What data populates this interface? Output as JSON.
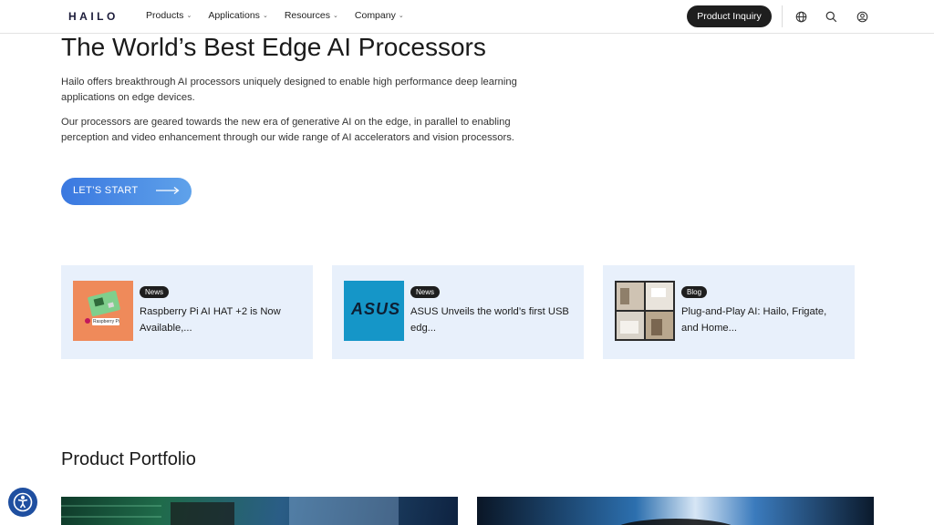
{
  "header": {
    "logo": "HAILO",
    "nav": [
      {
        "label": "Products"
      },
      {
        "label": "Applications"
      },
      {
        "label": "Resources"
      },
      {
        "label": "Company"
      }
    ],
    "inquiry_label": "Product Inquiry",
    "icons": [
      "globe-icon",
      "search-icon",
      "user-icon"
    ]
  },
  "hero": {
    "title": "The World’s Best Edge AI Processors",
    "p1": "Hailo offers breakthrough AI processors uniquely designed to enable high performance deep learning applications on edge devices.",
    "p2": "Our processors are geared towards the new era of generative AI on the edge, in parallel to enabling perception and video enhancement through our wide range of AI accelerators and vision processors.",
    "cta_label": "LET’S START"
  },
  "cards": [
    {
      "badge": "News",
      "title": "Raspberry Pi AI HAT +2 is Now Available,...",
      "thumb_text": "Raspberry Pi"
    },
    {
      "badge": "News",
      "title": "ASUS Unveils the world’s first USB edg...",
      "thumb_text": "ASUS"
    },
    {
      "badge": "Blog",
      "title": "Plug-and-Play AI: Hailo, Frigate, and Home..."
    }
  ],
  "portfolio": {
    "title": "Product Portfolio"
  },
  "colors": {
    "accent_start": "#3a78e0",
    "accent_end": "#5fa2ea",
    "card_bg": "#e8f0fb",
    "dark": "#1e1e1e"
  }
}
